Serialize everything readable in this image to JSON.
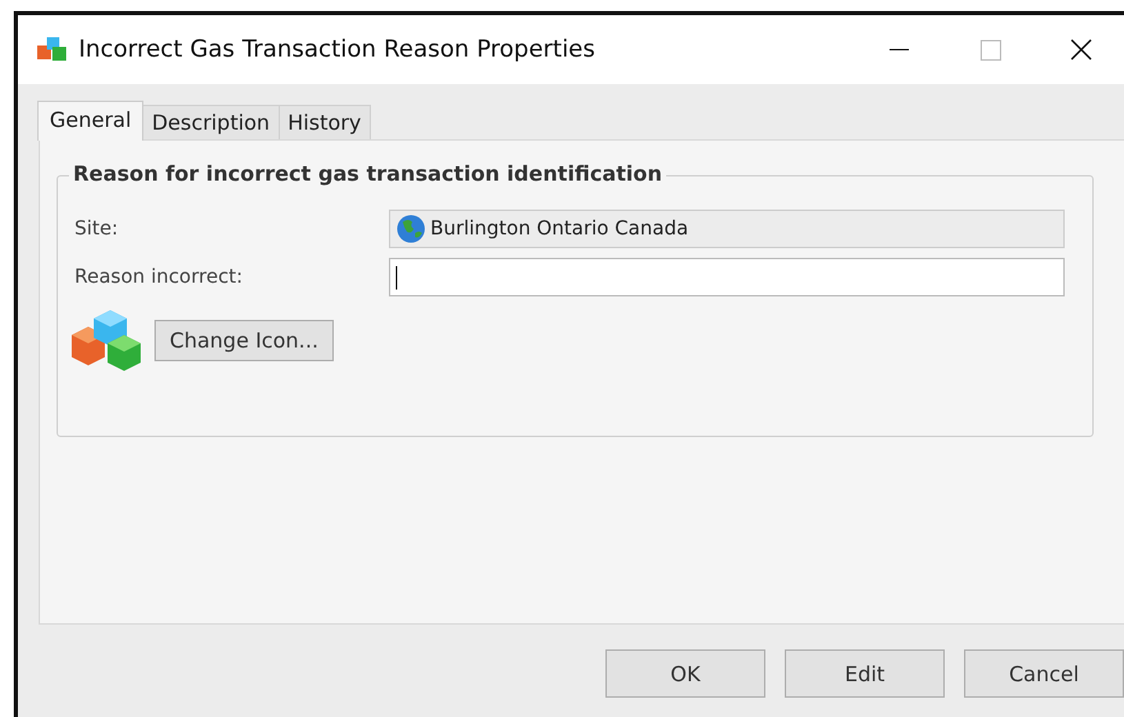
{
  "window": {
    "title": "Incorrect Gas Transaction Reason Properties"
  },
  "tabs": [
    {
      "label": "General",
      "selected": true
    },
    {
      "label": "Description",
      "selected": false
    },
    {
      "label": "History",
      "selected": false
    }
  ],
  "group": {
    "title": "Reason for incorrect gas transaction identification",
    "fields": [
      {
        "label": "Site:",
        "value": "Burlington Ontario Canada",
        "disabled": true
      },
      {
        "label": "Reason incorrect:",
        "disabled": false
      }
    ],
    "change_icon_button": "Change Icon..."
  },
  "buttons": [
    "OK",
    "Edit",
    "Cancel"
  ]
}
